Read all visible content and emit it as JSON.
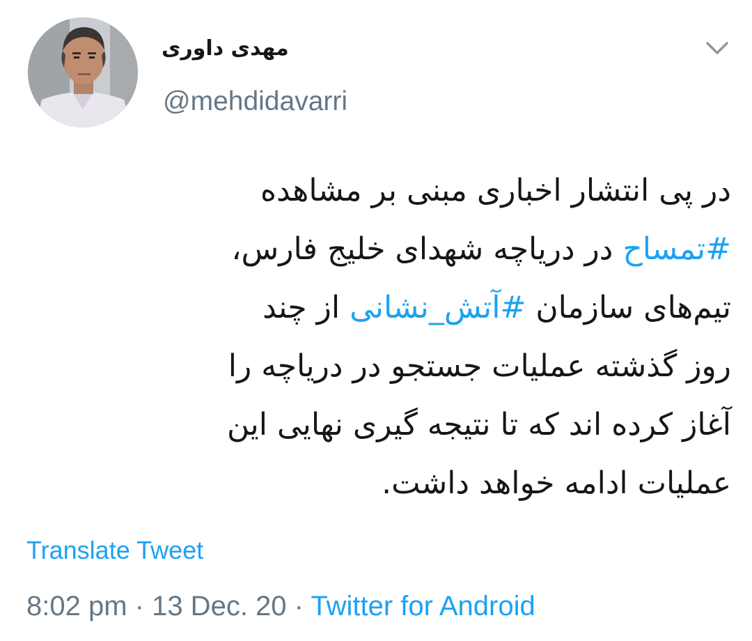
{
  "tweet": {
    "author": {
      "display_name": "مهدی داوری",
      "handle": "@mehdidavarri",
      "avatar_icon": "profile-photo"
    },
    "caret_icon": "chevron-down-icon",
    "body_lines": [
      {
        "segments": [
          {
            "text": "در پی انتشار اخباری مبنی بر مشاهده",
            "type": "text"
          }
        ]
      },
      {
        "segments": [
          {
            "text": "#تمساح",
            "type": "hashtag"
          },
          {
            "text": " در دریاچه شهدای خلیج فارس،",
            "type": "text"
          }
        ]
      },
      {
        "segments": [
          {
            "text": "تیم‌های سازمان ",
            "type": "text"
          },
          {
            "text": "#آتش_نشانی",
            "type": "hashtag"
          },
          {
            "text": " از چند",
            "type": "text"
          }
        ]
      },
      {
        "segments": [
          {
            "text": "روز گذشته عملیات جستجو در دریاچه را",
            "type": "text"
          }
        ]
      },
      {
        "segments": [
          {
            "text": "آغاز کرده اند که تا نتیجه گیری نهایی این",
            "type": "text"
          }
        ]
      },
      {
        "segments": [
          {
            "text": "عملیات ادامه خواهد داشت.",
            "type": "text"
          }
        ]
      }
    ],
    "translate_label": "Translate Tweet",
    "time": "8:02 pm",
    "separator": " · ",
    "date": "13 Dec. 20",
    "source": "Twitter for Android"
  },
  "colors": {
    "link": "#1da1f2",
    "secondary_text": "#657786",
    "primary_text": "#14171a",
    "background": "#ffffff"
  }
}
